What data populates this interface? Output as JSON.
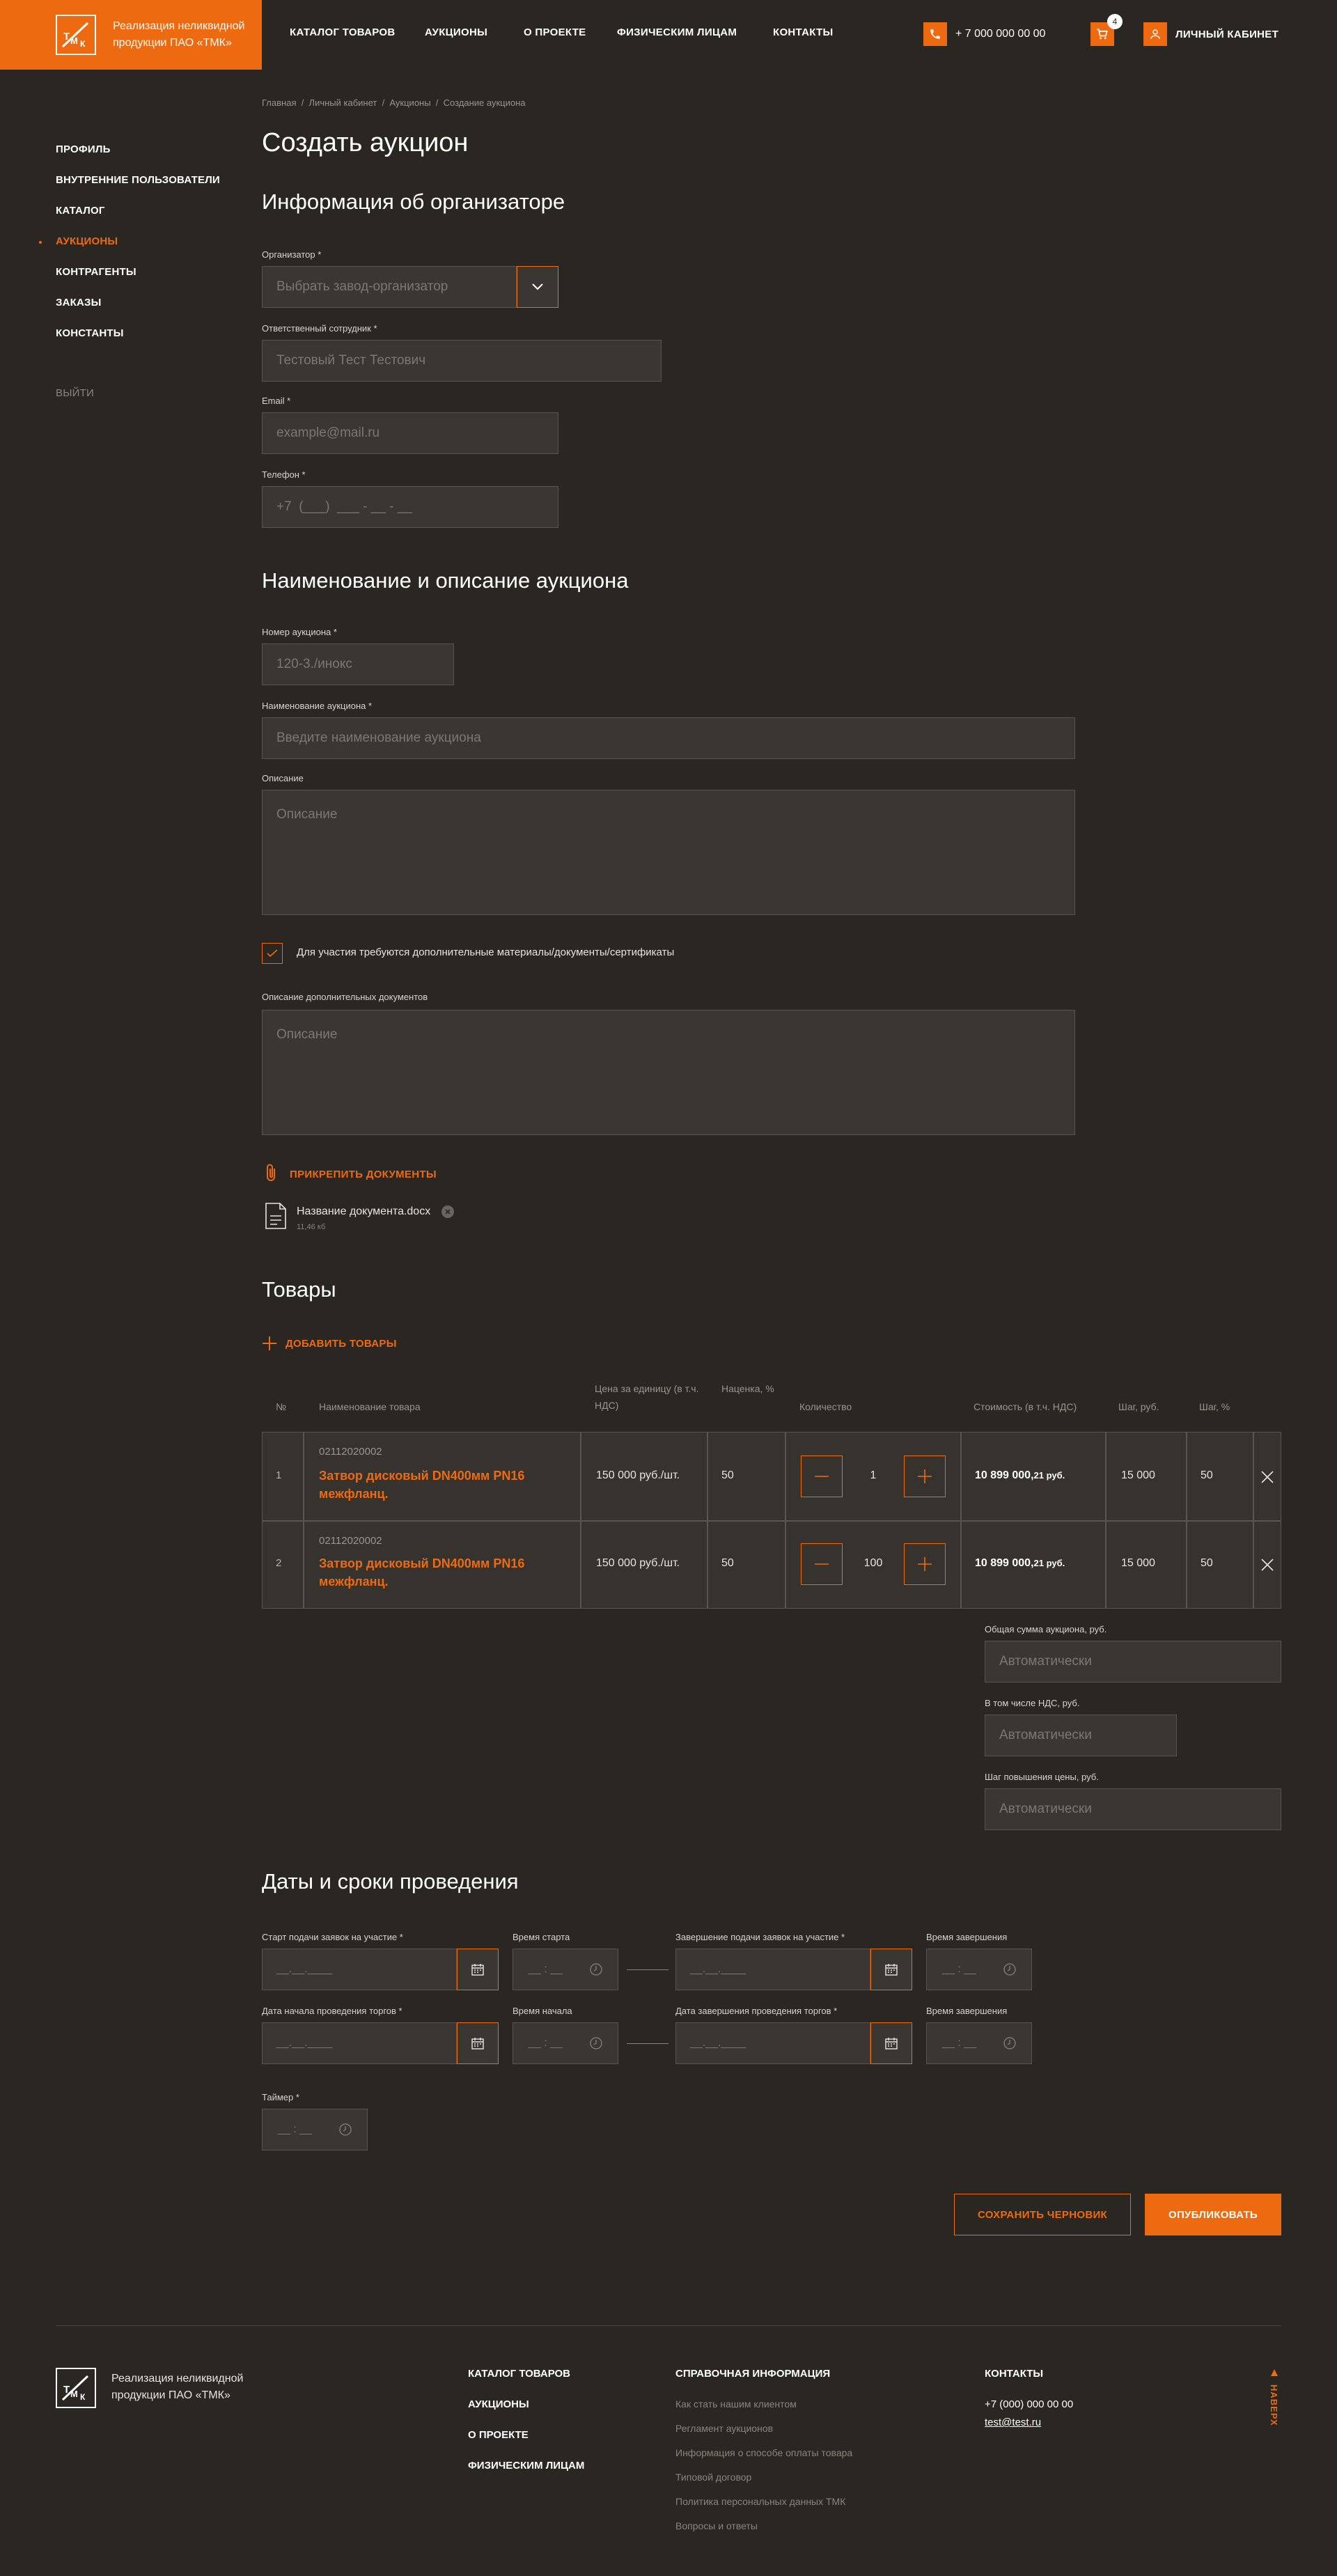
{
  "header": {
    "logo_text": "Реализация неликвидной продукции ПАО «ТМК»",
    "nav": [
      "КАТАЛОГ ТОВАРОВ",
      "АУКЦИОНЫ",
      "О ПРОЕКТЕ",
      "ФИЗИЧЕСКИМ ЛИЦАМ",
      "КОНТАКТЫ"
    ],
    "phone": "+ 7 000 000 00 00",
    "cart_count": "4",
    "account": "ЛИЧНЫЙ КАБИНЕТ"
  },
  "sidebar": {
    "items": [
      "ПРОФИЛЬ",
      "ВНУТРЕННИЕ ПОЛЬЗОВАТЕЛИ",
      "КАТАЛОГ",
      "АУКЦИОНЫ",
      "КОНТРАГЕНТЫ",
      "ЗАКАЗЫ",
      "КОНСТАНТЫ"
    ],
    "logout": "ВЫЙТИ"
  },
  "breadcrumb": "Главная  /  Личный кабинет  /  Аукционы  /  Создание аукциона",
  "page_title": "Создать аукцион",
  "org": {
    "title": "Информация об организаторе",
    "org_label": "Организатор *",
    "org_placeholder": "Выбрать завод-организатор",
    "resp_label": "Ответственный сотрудник *",
    "resp_value": "Тестовый Тест Тестович",
    "email_label": "Email *",
    "email_placeholder": "example@mail.ru",
    "phone_label": "Телефон *",
    "phone_placeholder": "+7  (___)  ___ - __ - __"
  },
  "desc": {
    "title": "Наименование и описание аукциона",
    "num_label": "Номер аукциона *",
    "num_value": "120-3./инокс",
    "name_label": "Наименование аукциона *",
    "name_placeholder": "Введите наименование аукциона",
    "desc_label": "Описание",
    "desc_placeholder": "Описание",
    "checkbox_label": "Для участия требуются дополнительные материалы/документы/сертификаты",
    "docs_label": "Описание дополнительных документов",
    "docs_placeholder": "Описание",
    "attach": "ПРИКРЕПИТЬ ДОКУМЕНТЫ",
    "file_name": "Название документа.docx",
    "file_size": "11,46 кб"
  },
  "goods": {
    "title": "Товары",
    "add": "ДОБАВИТЬ ТОВАРЫ",
    "headers": [
      "№",
      "Наименование товара",
      "Цена за единицу (в т.ч. НДС)",
      "Наценка, %",
      "Количество",
      "Стоимость (в т.ч. НДС)",
      "Шаг, руб.",
      "Шаг, %"
    ],
    "rows": [
      {
        "n": "1",
        "code": "02112020002",
        "name": "Затвор дисковый DN400мм PN16 межфланц.",
        "price": "150 000 руб./шт.",
        "markup": "50",
        "qty": "1",
        "cost_main": "10 899 000,",
        "cost_frac": "21 руб.",
        "step": "15 000",
        "step_pct": "50"
      },
      {
        "n": "2",
        "code": "02112020002",
        "name": "Затвор дисковый DN400мм PN16 межфланц.",
        "price": "150 000 руб./шт.",
        "markup": "50",
        "qty": "100",
        "cost_main": "10 899 000,",
        "cost_frac": "21 руб.",
        "step": "15 000",
        "step_pct": "50"
      }
    ],
    "total_label": "Общая сумма аукциона, руб.",
    "vat_label": "В том числе НДС, руб.",
    "raise_label": "Шаг повышения цены, руб.",
    "auto": "Автоматически"
  },
  "dates": {
    "title": "Даты и сроки проведения",
    "l1": "Старт подачи заявок на участие *",
    "l2": "Время старта",
    "l3": "Завершение подачи заявок на участие *",
    "l4": "Время завершения",
    "l5": "Дата начала проведения торгов *",
    "l6": "Время начала",
    "l7": "Дата завершения проведения торгов *",
    "l8": "Время завершения",
    "l9": "Таймер *",
    "date_ph": "__.__.____",
    "time_ph": "__ : __"
  },
  "actions": {
    "draft": "СОХРАНИТЬ ЧЕРНОВИК",
    "publish": "ОПУБЛИКОВАТЬ"
  },
  "footer": {
    "logo_text": "Реализация неликвидной продукции ПАО «ТМК»",
    "nav": [
      "КАТАЛОГ ТОВАРОВ",
      "АУКЦИОНЫ",
      "О ПРОЕКТЕ",
      "ФИЗИЧЕСКИМ ЛИЦАМ"
    ],
    "info_title": "СПРАВОЧНАЯ ИНФОРМАЦИЯ",
    "info": [
      "Как стать нашим клиентом",
      "Регламент аукционов",
      "Информация о способе оплаты товара",
      "Типовой договор",
      "Политика персональных данных ТМК",
      "Вопросы и ответы"
    ],
    "contacts_title": "КОНТАКТЫ",
    "contact_phone": "+7 (000) 000 00 00",
    "contact_email": "test@test.ru",
    "up": "НАВЕРХ"
  },
  "colors": {
    "accent": "#ee6a10",
    "bg": "#2a2622",
    "field": "#3a3632"
  }
}
